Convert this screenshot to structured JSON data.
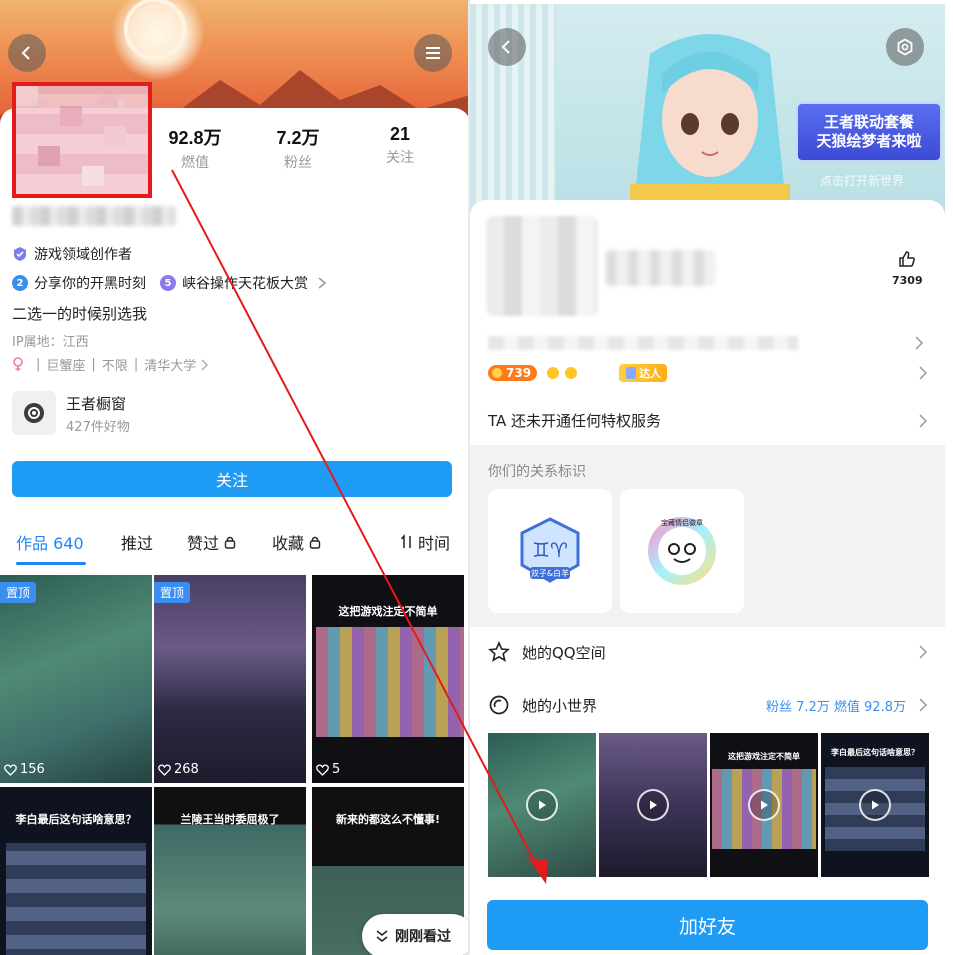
{
  "left": {
    "stats": [
      {
        "value": "92.8万",
        "label": "燃值"
      },
      {
        "value": "7.2万",
        "label": "粉丝"
      },
      {
        "value": "21",
        "label": "关注"
      }
    ],
    "creator_badge": "游戏领域创作者",
    "collections": [
      {
        "num": "2",
        "label": "分享你的开黑时刻"
      },
      {
        "num": "5",
        "label": "峡谷操作天花板大赏"
      }
    ],
    "bio": "二选一的时候别选我",
    "ip_location": "IP属地：江西",
    "tags": [
      "巨蟹座",
      "不限",
      "清华大学"
    ],
    "shop": {
      "title": "王者橱窗",
      "subtitle": "427件好物"
    },
    "follow_label": "关注",
    "tabs": [
      "作品 640",
      "推过",
      "赞过",
      "收藏"
    ],
    "sort_label": "时间",
    "tiles": [
      {
        "pin": "置顶",
        "likes": "156",
        "caption": ""
      },
      {
        "pin": "置顶",
        "likes": "268",
        "caption": ""
      },
      {
        "pin": "",
        "likes": "5",
        "caption": "这把游戏注定不简单"
      },
      {
        "pin": "",
        "likes": "",
        "caption": "李白最后这句话啥意思？"
      },
      {
        "pin": "",
        "likes": "",
        "caption": "兰陵王当时委屈极了"
      },
      {
        "pin": "",
        "likes": "",
        "caption": "新来的都这么不懂事!"
      }
    ],
    "just_seen_label": "刚刚看过"
  },
  "right": {
    "promo": {
      "line1": "王者联动套餐",
      "line2": "天狼绘梦者来啦"
    },
    "banner_hint": "点击打开新世界",
    "likes_count": "7309",
    "points": "739",
    "badge_daren": "达人",
    "privilege_text": "TA 还未开通任何特权服务",
    "relation_title": "你们的关系标识",
    "relation_cards": [
      {
        "label": "双子&白羊"
      },
      {
        "label": "宝藏情侣徽章"
      }
    ],
    "qzone_label": "她的QQ空间",
    "world_label": "她的小世界",
    "world_stats": "粉丝 7.2万  燃值 92.8万",
    "world_thumbs": [
      {
        "caption": ""
      },
      {
        "caption": ""
      },
      {
        "caption": "这把游戏注定不简单"
      },
      {
        "caption": "李白最后这句话啥意思？"
      }
    ],
    "add_friend_label": "加好友"
  },
  "colors": {
    "accent": "#1e9bf5",
    "annotation_red": "#e31b1b",
    "link_blue": "#3a8ef0"
  }
}
